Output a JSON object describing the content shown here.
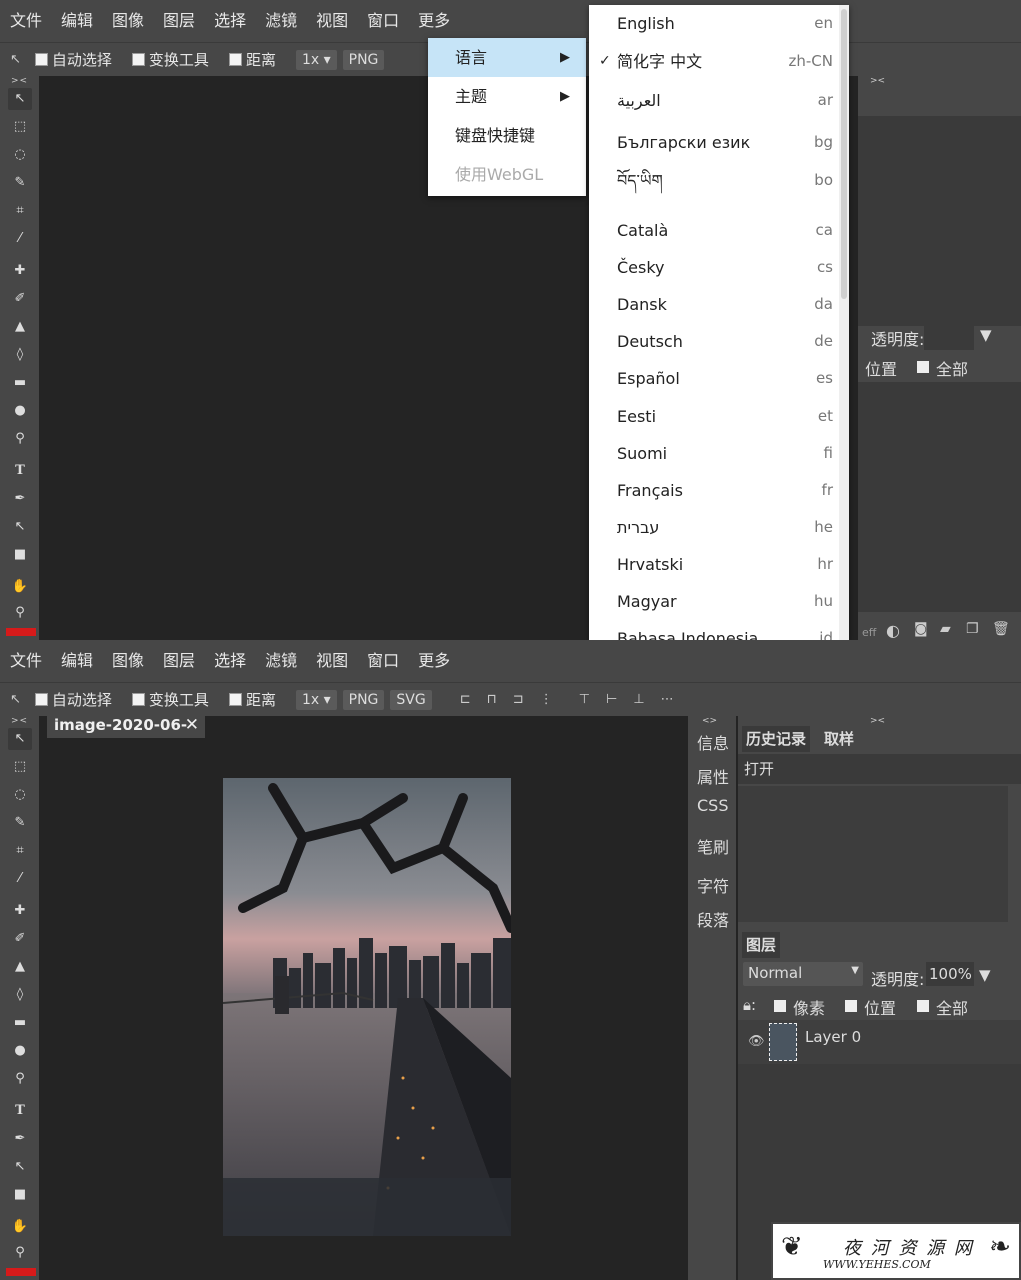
{
  "menubar": {
    "items": [
      "文件",
      "编辑",
      "图像",
      "图层",
      "选择",
      "滤镜",
      "视图",
      "窗口",
      "更多"
    ]
  },
  "options": {
    "auto_select": "自动选择",
    "transform_tools": "变换工具",
    "distance": "距离",
    "scale": "1x",
    "png": "PNG",
    "svg": "SVG"
  },
  "more_menu": {
    "items": [
      {
        "label": "语言",
        "has_submenu": true
      },
      {
        "label": "主题",
        "has_submenu": true
      },
      {
        "label": "键盘快捷键",
        "has_submenu": false
      },
      {
        "label": "使用WebGL",
        "disabled": true
      }
    ]
  },
  "languages": [
    {
      "name": "English",
      "code": "en"
    },
    {
      "name": "简化字 中文",
      "code": "zh-CN",
      "checked": true
    },
    {
      "name": "العربية",
      "code": "ar"
    },
    {
      "name": "Български език",
      "code": "bg"
    },
    {
      "name": "བོད་ཡིག",
      "code": "bo"
    },
    {
      "name": "Català",
      "code": "ca"
    },
    {
      "name": "Česky",
      "code": "cs"
    },
    {
      "name": "Dansk",
      "code": "da"
    },
    {
      "name": "Deutsch",
      "code": "de"
    },
    {
      "name": "Español",
      "code": "es"
    },
    {
      "name": "Eesti",
      "code": "et"
    },
    {
      "name": "Suomi",
      "code": "fi"
    },
    {
      "name": "Français",
      "code": "fr"
    },
    {
      "name": "עברית",
      "code": "he"
    },
    {
      "name": "Hrvatski",
      "code": "hr"
    },
    {
      "name": "Magyar",
      "code": "hu"
    },
    {
      "name": "Bahasa Indonesia",
      "code": "id"
    }
  ],
  "screen1_panel": {
    "opacity_label": "透明度:",
    "lock_position": "位置",
    "lock_all": "全部",
    "eff_label": "eff"
  },
  "document": {
    "tab_title": "image-2020-06-",
    "close": "✕"
  },
  "side_tabs": [
    "信息",
    "属性",
    "CSS",
    "笔刷",
    "字符",
    "段落"
  ],
  "history_panel": {
    "tab_history": "历史记录",
    "tab_sample": "取样",
    "entry": "打开"
  },
  "layers_panel": {
    "title": "图层",
    "blend_mode": "Normal",
    "opacity_label": "透明度:",
    "opacity_value": "100%",
    "lock_pixels": "像素",
    "lock_position": "位置",
    "lock_all": "全部",
    "layer_name": "Layer 0"
  },
  "watermark": {
    "title": "夜 河 资 源 网",
    "url": "WWW.YEHES.COM"
  },
  "colors": {
    "foreground": "#d61a1a",
    "highlight": "#c6e4f7",
    "panel": "#474747",
    "canvas": "#242424"
  }
}
